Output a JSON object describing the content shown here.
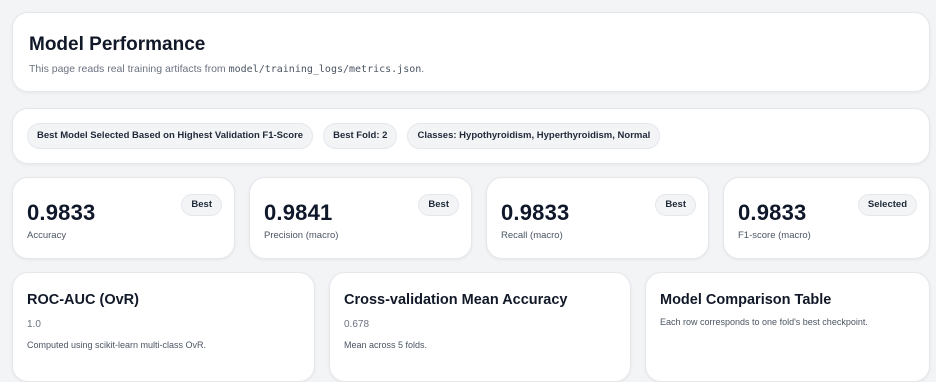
{
  "header": {
    "title": "Model Performance",
    "subtitle_prefix": "This page reads real training artifacts from ",
    "subtitle_path": "model/training_logs/metrics.json",
    "subtitle_suffix": "."
  },
  "chips": [
    "Best Model Selected Based on Highest Validation F1-Score",
    "Best Fold: 2",
    "Classes: Hypothyroidism, Hyperthyroidism, Normal"
  ],
  "metrics": [
    {
      "value": "0.9833",
      "label": "Accuracy",
      "badge": "Best"
    },
    {
      "value": "0.9841",
      "label": "Precision (macro)",
      "badge": "Best"
    },
    {
      "value": "0.9833",
      "label": "Recall (macro)",
      "badge": "Best"
    },
    {
      "value": "0.9833",
      "label": "F1-score (macro)",
      "badge": "Selected"
    }
  ],
  "info": {
    "roc": {
      "title": "ROC-AUC (OvR)",
      "value": "1.0",
      "note": "Computed using scikit-learn multi-class OvR."
    },
    "cv": {
      "title": "Cross-validation Mean Accuracy",
      "value": "0.678",
      "note": "Mean across 5 folds."
    },
    "table": {
      "title": "Model Comparison Table",
      "note": "Each row corresponds to one fold's best checkpoint."
    }
  }
}
